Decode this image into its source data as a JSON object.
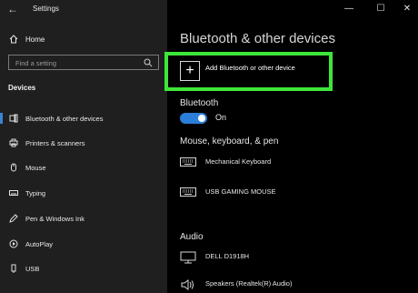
{
  "window": {
    "title": "Settings",
    "controls": {
      "minimize": "—",
      "maximize": "☐",
      "close": "✕"
    }
  },
  "sidebar": {
    "home_label": "Home",
    "search_placeholder": "Find a setting",
    "section_label": "Devices",
    "items": [
      {
        "label": "Bluetooth & other devices",
        "icon": "bluetooth-icon",
        "selected": true
      },
      {
        "label": "Printers & scanners",
        "icon": "printer-icon",
        "selected": false
      },
      {
        "label": "Mouse",
        "icon": "mouse-icon",
        "selected": false
      },
      {
        "label": "Typing",
        "icon": "keyboard-icon",
        "selected": false
      },
      {
        "label": "Pen & Windows Ink",
        "icon": "pen-icon",
        "selected": false
      },
      {
        "label": "AutoPlay",
        "icon": "autoplay-icon",
        "selected": false
      },
      {
        "label": "USB",
        "icon": "usb-icon",
        "selected": false
      }
    ]
  },
  "main": {
    "title": "Bluetooth & other devices",
    "add_device_label": "Add Bluetooth or other device",
    "bluetooth_heading": "Bluetooth",
    "bluetooth_state": "On",
    "mouse_section": "Mouse, keyboard, & pen",
    "input_devices": [
      {
        "name": "Mechanical Keyboard",
        "icon": "keyboard-icon"
      },
      {
        "name": "USB GAMING MOUSE",
        "icon": "keyboard-icon"
      }
    ],
    "audio_section": "Audio",
    "audio_devices": [
      {
        "name": "DELL D1918H",
        "icon": "monitor-icon"
      },
      {
        "name": "Speakers (Realtek(R) Audio)",
        "icon": "speaker-icon"
      }
    ]
  },
  "colors": {
    "accent": "#2b7fd8",
    "highlight": "#3ee63a",
    "sidebar_bg": "#1f1f1f",
    "main_bg": "#000000"
  }
}
